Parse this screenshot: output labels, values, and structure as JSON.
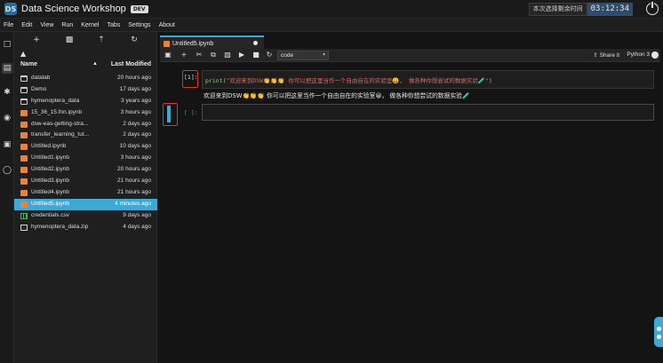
{
  "header": {
    "title": "Data Science Workshop",
    "badge": "DEV",
    "timer_label": "本次选择剩余时间",
    "timer_value": "03:12:34"
  },
  "menu": [
    "File",
    "Edit",
    "View",
    "Run",
    "Kernel",
    "Tabs",
    "Settings",
    "About"
  ],
  "filebrowser": {
    "col_name": "Name",
    "col_modified": "Last Modified",
    "files": [
      {
        "name": "datalab",
        "modified": "20 hours ago",
        "type": "folder"
      },
      {
        "name": "Demo",
        "modified": "17 days ago",
        "type": "folder"
      },
      {
        "name": "hymenoptera_data",
        "modified": "3 years ago",
        "type": "folder"
      },
      {
        "name": "15_36_15.fnn.ipynb",
        "modified": "3 hours ago",
        "type": "notebook"
      },
      {
        "name": "dsw-eas-getting-stra...",
        "modified": "2 days ago",
        "type": "notebook"
      },
      {
        "name": "transfer_learning_tut...",
        "modified": "2 days ago",
        "type": "notebook"
      },
      {
        "name": "Untitled.ipynb",
        "modified": "10 days ago",
        "type": "notebook"
      },
      {
        "name": "Untitled1.ipynb",
        "modified": "3 hours ago",
        "type": "notebook"
      },
      {
        "name": "Untitled2.ipynb",
        "modified": "20 hours ago",
        "type": "notebook"
      },
      {
        "name": "Untitled3.ipynb",
        "modified": "21 hours ago",
        "type": "notebook"
      },
      {
        "name": "Untitled4.ipynb",
        "modified": "21 hours ago",
        "type": "notebook"
      },
      {
        "name": "Untitled5.ipynb",
        "modified": "4 minutes ago",
        "type": "notebook",
        "selected": true
      },
      {
        "name": "credentials.csv",
        "modified": "9 days ago",
        "type": "csv"
      },
      {
        "name": "hymenoptera_data.zip",
        "modified": "4 days ago",
        "type": "zip"
      }
    ]
  },
  "notebook": {
    "tab_label": "Untitled5.ipynb",
    "cell_type": "code",
    "share_label": "Share it",
    "kernel": "Python 3",
    "cells": [
      {
        "prompt": "[1]:",
        "code_prefix": "print(",
        "code_string": "\"欢迎来到DSW👏👏👏  你可以把这里当作一个自由自在的实验室😀， 做各种你想尝试的数据实验🧪\"",
        "code_suffix": ")",
        "output": "欢迎来到DSW👏👏👏  你可以把这里当作一个自由自在的实验室😀， 做各种你想尝试的数据实验🧪"
      },
      {
        "prompt": "[ ]:"
      }
    ]
  },
  "colors": {
    "accent": "#3fa9d6",
    "highlight_box": "#e0312b",
    "notebook_icon": "#e8833a"
  }
}
